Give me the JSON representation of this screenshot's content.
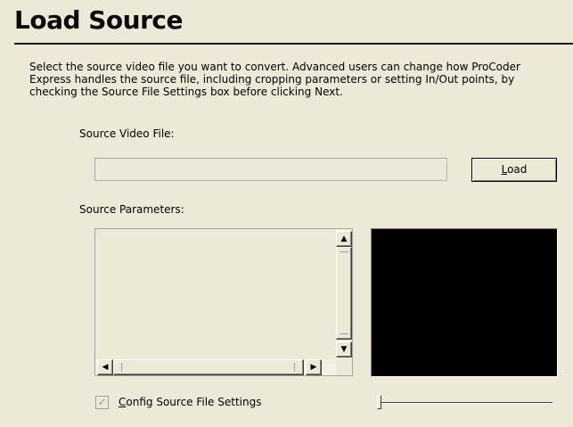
{
  "page": {
    "title": "Load Source",
    "description": "Select the source video file you want to convert. Advanced users can change how ProCoder Express handles the source file, including cropping parameters or setting In/Out points, by checking the Source File Settings box before clicking Next."
  },
  "source_video": {
    "label": "Source Video File:",
    "value": "",
    "load_button_accel": "L",
    "load_button_rest": "oad"
  },
  "source_params": {
    "label": "Source Parameters:"
  },
  "scroll": {
    "up_icon": "▲",
    "down_icon": "▼",
    "left_icon": "◀",
    "right_icon": "▶"
  },
  "config": {
    "checkbox_label_accel": "C",
    "checkbox_label_rest": "onfig Source File Settings",
    "checked": true,
    "check_glyph": "✓"
  },
  "colors": {
    "background": "#ece9d8",
    "preview": "#000000"
  }
}
